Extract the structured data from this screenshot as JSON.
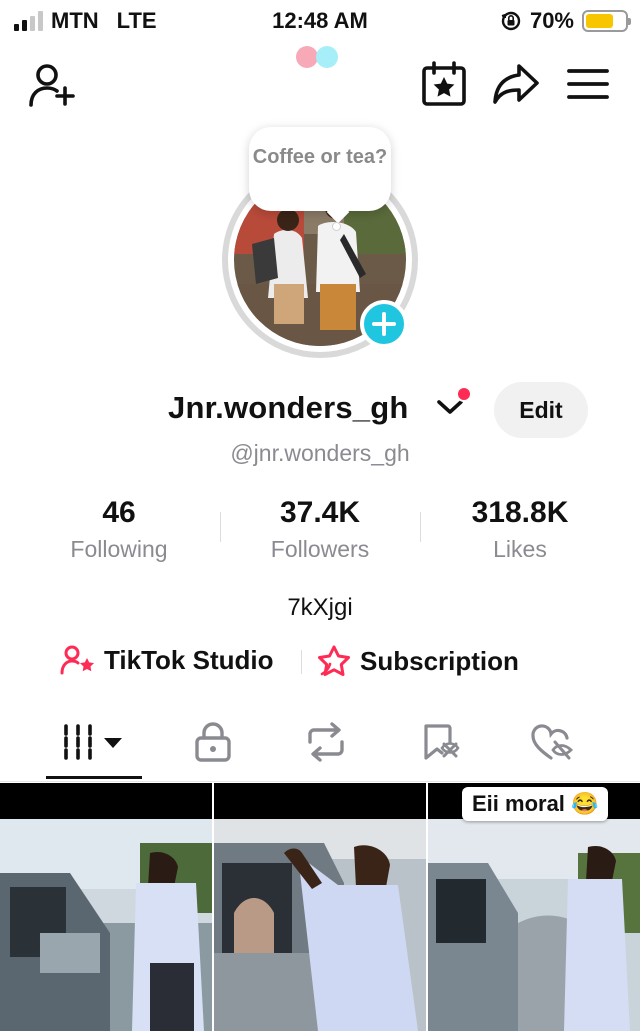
{
  "status_bar": {
    "carrier": "MTN",
    "network": "LTE",
    "time": "12:48 AM",
    "battery_percent": "70%",
    "battery_level": 0.7,
    "signal_bars_on": 2,
    "signal_bars_total": 4
  },
  "top_nav": {
    "icons": [
      "add-friend-icon",
      "calendar-star-icon",
      "share-icon",
      "menu-icon"
    ]
  },
  "avatar": {
    "note_text": "Coffee or tea?"
  },
  "profile": {
    "display_name": "Jnr.wonders_gh",
    "handle": "@jnr.wonders_gh",
    "edit_label": "Edit",
    "bio": "7kXjgi"
  },
  "stats": [
    {
      "value": "46",
      "label": "Following"
    },
    {
      "value": "37.4K",
      "label": "Followers"
    },
    {
      "value": "318.8K",
      "label": "Likes"
    }
  ],
  "links": {
    "studio_label": "TikTok Studio",
    "subscription_label": "Subscription"
  },
  "tabs": [
    "videos-grid-icon",
    "lock-icon",
    "repost-icon",
    "bookmark-icon",
    "liked-icon"
  ],
  "videos": [
    {
      "overlay": ""
    },
    {
      "overlay": ""
    },
    {
      "overlay": "Eii moral 😂"
    }
  ],
  "colors": {
    "accent_red": "#fe2c55",
    "accent_cyan": "#20c5e0",
    "muted_text": "#8a8b91"
  }
}
